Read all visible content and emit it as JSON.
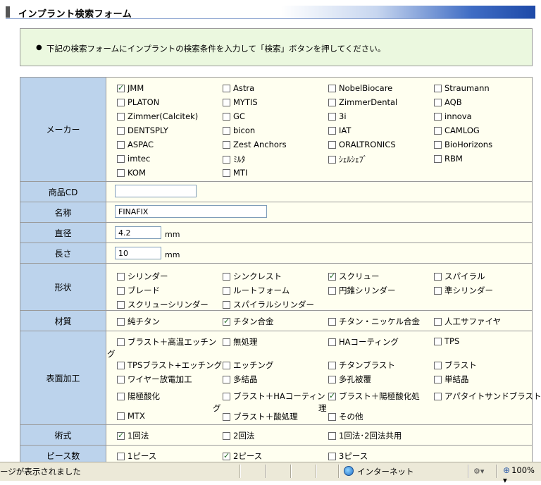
{
  "header": {
    "title": "インプラント検索フォーム"
  },
  "notice": {
    "bullet": "●",
    "text": "下記の検索フォームにインプラントの検索条件を入力して「検索」ボタンを押してください。"
  },
  "form": {
    "maker": {
      "label": "メーカー",
      "options": [
        {
          "label": "JMM",
          "checked": true
        },
        {
          "label": "Astra",
          "checked": false
        },
        {
          "label": "NobelBiocare",
          "checked": false
        },
        {
          "label": "Straumann",
          "checked": false
        },
        {
          "label": "PLATON",
          "checked": false
        },
        {
          "label": "MYTIS",
          "checked": false
        },
        {
          "label": "ZimmerDental",
          "checked": false
        },
        {
          "label": "AQB",
          "checked": false
        },
        {
          "label": "Zimmer(Calcitek)",
          "checked": false
        },
        {
          "label": "GC",
          "checked": false
        },
        {
          "label": "3i",
          "checked": false
        },
        {
          "label": "innova",
          "checked": false
        },
        {
          "label": "DENTSPLY",
          "checked": false
        },
        {
          "label": "bicon",
          "checked": false
        },
        {
          "label": "IAT",
          "checked": false
        },
        {
          "label": "CAMLOG",
          "checked": false
        },
        {
          "label": "ASPAC",
          "checked": false
        },
        {
          "label": "Zest Anchors",
          "checked": false
        },
        {
          "label": "ORALTRONICS",
          "checked": false
        },
        {
          "label": "BioHorizons",
          "checked": false
        },
        {
          "label": "imtec",
          "checked": false
        },
        {
          "label": "ﾐﾙﾀ",
          "checked": false
        },
        {
          "label": "ｼｪﾙｼｪﾌﾞ",
          "checked": false
        },
        {
          "label": "RBM",
          "checked": false
        },
        {
          "label": "KOM",
          "checked": false
        },
        {
          "label": "MTI",
          "checked": false
        }
      ]
    },
    "product_cd": {
      "label": "商品CD",
      "value": ""
    },
    "name": {
      "label": "名称",
      "value": "FINAFIX"
    },
    "diameter": {
      "label": "直径",
      "value": "4.2",
      "unit": "mm"
    },
    "length": {
      "label": "長さ",
      "value": "10",
      "unit": "mm"
    },
    "shape": {
      "label": "形状",
      "options": [
        {
          "label": "シリンダー",
          "checked": false
        },
        {
          "label": "シンクレスト",
          "checked": false
        },
        {
          "label": "スクリュー",
          "checked": true
        },
        {
          "label": "スパイラル",
          "checked": false
        },
        {
          "label": "ブレード",
          "checked": false
        },
        {
          "label": "ルートフォーム",
          "checked": false
        },
        {
          "label": "円錐シリンダー",
          "checked": false
        },
        {
          "label": "準シリンダー",
          "checked": false
        },
        {
          "label": "スクリューシリンダー",
          "checked": false
        },
        {
          "label": "スパイラルシリンダー",
          "checked": false
        }
      ]
    },
    "material": {
      "label": "材質",
      "options": [
        {
          "label": "純チタン",
          "checked": false
        },
        {
          "label": "チタン合金",
          "checked": true
        },
        {
          "label": "チタン・ニッケル合金",
          "checked": false
        },
        {
          "label": "人工サファイヤ",
          "checked": false
        }
      ]
    },
    "surface": {
      "label": "表面加工",
      "options": [
        {
          "label": "ブラスト＋高温エッチン",
          "wrap": "グ",
          "checked": false
        },
        {
          "label": "無処理",
          "checked": false
        },
        {
          "label": "HAコーティング",
          "checked": false
        },
        {
          "label": "TPS",
          "checked": false
        },
        {
          "label": "TPSブラスト+エッチング",
          "checked": false
        },
        {
          "label": "エッチング",
          "checked": false
        },
        {
          "label": "チタンブラスト",
          "checked": false
        },
        {
          "label": "ブラスト",
          "checked": false
        },
        {
          "label": "ワイヤー放電加工",
          "checked": false
        },
        {
          "label": "多結晶",
          "checked": false
        },
        {
          "label": "多孔被覆",
          "checked": false
        },
        {
          "label": "単結晶",
          "checked": false
        },
        {
          "label": "陽極酸化",
          "checked": false
        },
        {
          "label": "ブラスト＋HAコーティン",
          "wrap": "グ",
          "checked": false
        },
        {
          "label": "ブラスト＋陽極酸化処",
          "wrap": "理",
          "checked": true
        },
        {
          "label": "アパタイトサンドブラスト",
          "checked": false
        },
        {
          "label": "MTX",
          "checked": false
        },
        {
          "label": "ブラスト＋酸処理",
          "checked": false
        },
        {
          "label": "その他",
          "checked": false
        }
      ]
    },
    "method": {
      "label": "術式",
      "options": [
        {
          "label": "1回法",
          "checked": true
        },
        {
          "label": "2回法",
          "checked": false
        },
        {
          "label": "1回法･2回法共用",
          "checked": false
        }
      ]
    },
    "pieces": {
      "label": "ピース数",
      "options": [
        {
          "label": "1ピース",
          "checked": false
        },
        {
          "label": "2ピース",
          "checked": true
        },
        {
          "label": "3ピース",
          "checked": false
        }
      ]
    }
  },
  "statusbar": {
    "text": "ージが表示されました",
    "zone": "インターネット",
    "lock_icon": "▾",
    "zoom": "100%",
    "zoom_menu": "▾"
  }
}
